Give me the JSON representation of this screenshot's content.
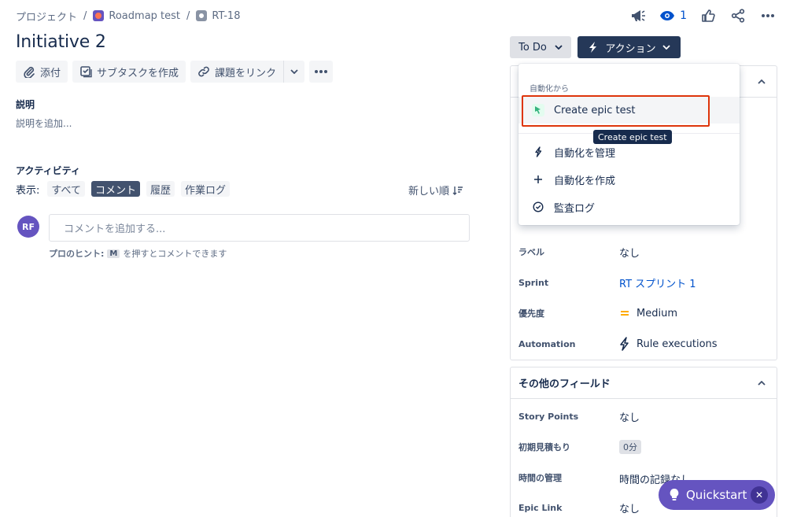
{
  "breadcrumb": {
    "project": "プロジェクト",
    "sep": "/",
    "board": "Roadmap test",
    "issue_key": "RT-18"
  },
  "top_actions": {
    "watch_count": "1"
  },
  "issue": {
    "title": "Initiative 2"
  },
  "toolbar": {
    "attach": "添付",
    "subtask": "サブタスクを作成",
    "link": "課題をリンク"
  },
  "description": {
    "heading": "説明",
    "placeholder": "説明を追加..."
  },
  "activity": {
    "heading": "アクティビティ",
    "show_label": "表示:",
    "filters": [
      "すべて",
      "コメント",
      "履歴",
      "作業ログ"
    ],
    "active_filter": "コメント",
    "sort": "新しい順"
  },
  "comment": {
    "avatar": "RF",
    "placeholder": "コメントを追加する...",
    "hint_prefix": "プロのヒント:",
    "hint_key": "M",
    "hint_suffix": "を押すとコメントできます"
  },
  "status_button": {
    "label": "To Do"
  },
  "action_button": {
    "label": "アクション"
  },
  "dropdown": {
    "group_label": "自動化から",
    "items": [
      {
        "label": "Create epic test",
        "icon": "epic-cursor-icon"
      },
      {
        "label": "自動化を管理",
        "icon": "bolt-icon"
      },
      {
        "label": "自動化を作成",
        "icon": "plus-icon"
      },
      {
        "label": "監査ログ",
        "icon": "check-circle-icon"
      }
    ]
  },
  "tooltip": "Create epic test",
  "details": {
    "fields": [
      {
        "label": "ラベル",
        "value": "なし"
      },
      {
        "label": "Sprint",
        "value": "RT スプリント 1"
      },
      {
        "label": "優先度",
        "value": "Medium"
      },
      {
        "label": "Automation",
        "value": "Rule executions"
      }
    ]
  },
  "more_fields": {
    "heading": "その他のフィールド",
    "fields": [
      {
        "label": "Story Points",
        "value": "なし"
      },
      {
        "label": "初期見積もり",
        "value": "0分"
      },
      {
        "label": "時間の管理",
        "value": "時間の記録なし"
      },
      {
        "label": "Epic Link",
        "value": "なし"
      }
    ]
  },
  "quickstart": {
    "label": "Quickstart"
  },
  "colors": {
    "accent": "#0052cc",
    "dark": "#253858",
    "purple": "#6554c0",
    "highlight": "#de350b"
  }
}
